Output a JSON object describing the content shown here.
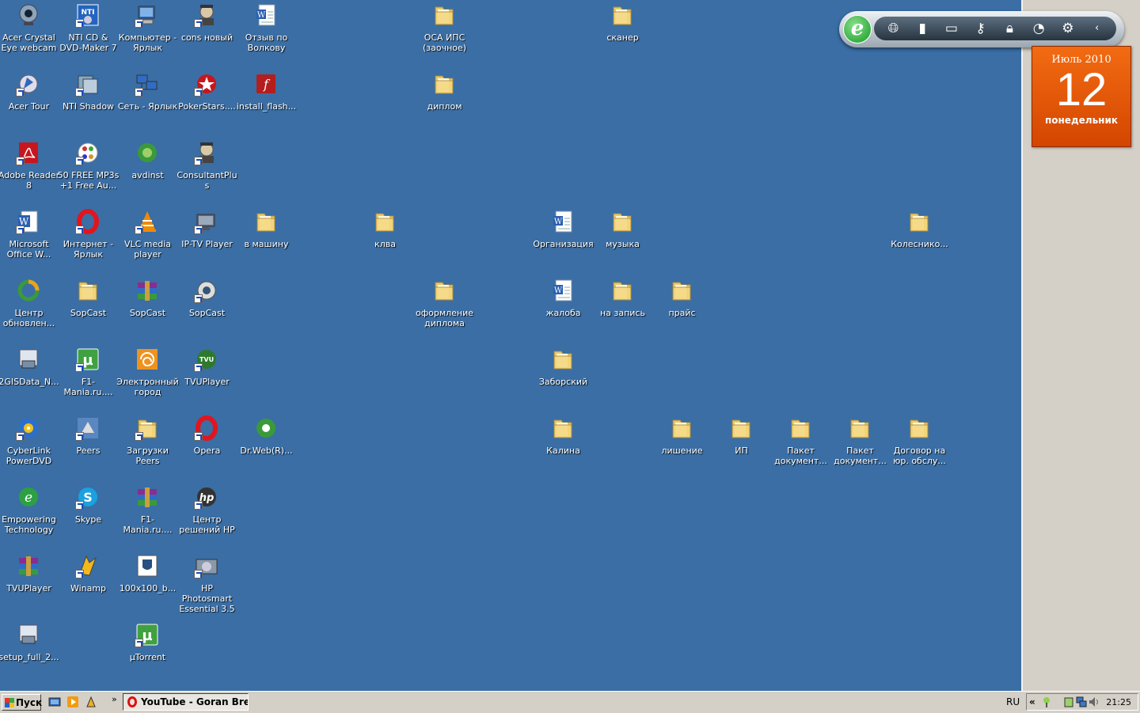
{
  "desktop": {
    "background": "#3a6ea5",
    "icons": [
      {
        "label": "Acer Crystal\nEye webcam",
        "icon": "webcam-icon",
        "shortcut": false
      },
      {
        "label": "NTI CD &\nDVD-Maker 7",
        "icon": "nti-cd-icon",
        "shortcut": true
      },
      {
        "label": "Компьютер -\nЯрлык",
        "icon": "computer-icon",
        "shortcut": true
      },
      {
        "label": "cons новый",
        "icon": "consultant-icon",
        "shortcut": true
      },
      {
        "label": "Отзыв по\nВолкову",
        "icon": "word-doc-icon",
        "shortcut": false
      },
      {
        "label": "ОСА ИПС\n(заочное)",
        "icon": "folder-icon",
        "shortcut": false
      },
      {
        "label": "сканер",
        "icon": "folder-icon",
        "shortcut": false
      },
      {
        "label": "Acer Tour",
        "icon": "acer-tour-icon",
        "shortcut": true
      },
      {
        "label": "NTI Shadow",
        "icon": "nti-shadow-icon",
        "shortcut": true
      },
      {
        "label": "Сеть - Ярлык",
        "icon": "network-icon",
        "shortcut": true
      },
      {
        "label": "PokerStars....",
        "icon": "pokerstars-icon",
        "shortcut": true
      },
      {
        "label": "install_flash...",
        "icon": "flash-installer-icon",
        "shortcut": false
      },
      {
        "label": "диплом",
        "icon": "folder-icon",
        "shortcut": false
      },
      {
        "label": "Adobe Reader\n8",
        "icon": "adobe-reader-icon",
        "shortcut": true
      },
      {
        "label": "50 FREE MP3s\n+1 Free Au...",
        "icon": "mp3-icon",
        "shortcut": true
      },
      {
        "label": "avdinst",
        "icon": "avdinst-icon",
        "shortcut": false
      },
      {
        "label": "ConsultantPlus",
        "icon": "consultant-icon",
        "shortcut": true
      },
      {
        "label": "Microsoft\nOffice W...",
        "icon": "word-icon",
        "shortcut": true
      },
      {
        "label": "Интернет -\nЯрлык",
        "icon": "opera-icon",
        "shortcut": true
      },
      {
        "label": "VLC media\nplayer",
        "icon": "vlc-icon",
        "shortcut": true
      },
      {
        "label": "IP-TV Player",
        "icon": "iptv-icon",
        "shortcut": true
      },
      {
        "label": "в машину",
        "icon": "folder-icon",
        "shortcut": false
      },
      {
        "label": "клва",
        "icon": "folder-icon",
        "shortcut": false
      },
      {
        "label": "Организация",
        "icon": "word-doc-icon",
        "shortcut": false
      },
      {
        "label": "музыка",
        "icon": "folder-icon",
        "shortcut": false
      },
      {
        "label": "Колеснико...",
        "icon": "folder-icon",
        "shortcut": false
      },
      {
        "label": "Центр\nобновлен...",
        "icon": "update-center-icon",
        "shortcut": false
      },
      {
        "label": "SopCast",
        "icon": "folder-icon",
        "shortcut": false
      },
      {
        "label": "SopCast",
        "icon": "winrar-icon",
        "shortcut": false
      },
      {
        "label": "SopCast",
        "icon": "sopcast-icon",
        "shortcut": true
      },
      {
        "label": "оформление\nдиплома",
        "icon": "folder-icon",
        "shortcut": false
      },
      {
        "label": "жалоба",
        "icon": "word-doc-icon",
        "shortcut": false
      },
      {
        "label": "на запись",
        "icon": "folder-icon",
        "shortcut": false
      },
      {
        "label": "прайс",
        "icon": "folder-icon",
        "shortcut": false
      },
      {
        "label": "2GISData_N...",
        "icon": "installer-icon",
        "shortcut": false
      },
      {
        "label": "F1-Mania.ru....",
        "icon": "utorrent-icon",
        "shortcut": true
      },
      {
        "label": "Электронный\nгород",
        "icon": "city-icon",
        "shortcut": false
      },
      {
        "label": "TVUPlayer",
        "icon": "tvu-icon",
        "shortcut": true
      },
      {
        "label": "Заборский",
        "icon": "folder-icon",
        "shortcut": false
      },
      {
        "label": "CyberLink\nPowerDVD",
        "icon": "powerdvd-icon",
        "shortcut": true
      },
      {
        "label": "Peers",
        "icon": "peers-icon",
        "shortcut": true
      },
      {
        "label": "Загрузки\nPeers",
        "icon": "folder-icon",
        "shortcut": true
      },
      {
        "label": "Opera",
        "icon": "opera-icon",
        "shortcut": true
      },
      {
        "label": "Dr.Web(R)...",
        "icon": "drweb-icon",
        "shortcut": false
      },
      {
        "label": "Калина",
        "icon": "folder-icon",
        "shortcut": false
      },
      {
        "label": "лишение",
        "icon": "folder-icon",
        "shortcut": false
      },
      {
        "label": "ИП",
        "icon": "folder-icon",
        "shortcut": false
      },
      {
        "label": "Пакет\nдокумент...",
        "icon": "folder-icon",
        "shortcut": false
      },
      {
        "label": "Пакет\nдокумент...",
        "icon": "folder-icon",
        "shortcut": false
      },
      {
        "label": "Договор на\nюр. обслу...",
        "icon": "folder-icon",
        "shortcut": false
      },
      {
        "label": "Empowering\nTechnology",
        "icon": "empowering-icon",
        "shortcut": false
      },
      {
        "label": "Skype",
        "icon": "skype-icon",
        "shortcut": true
      },
      {
        "label": "F1-Mania.ru....",
        "icon": "winrar-icon",
        "shortcut": false
      },
      {
        "label": "Центр\nрешений HP",
        "icon": "hp-icon",
        "shortcut": true
      },
      {
        "label": "TVUPlayer",
        "icon": "winrar-icon",
        "shortcut": false
      },
      {
        "label": "Winamp",
        "icon": "winamp-icon",
        "shortcut": true
      },
      {
        "label": "100x100_b...",
        "icon": "image-icon",
        "shortcut": false
      },
      {
        "label": "HP Photosmart\nEssential 3.5",
        "icon": "hp-photosmart-icon",
        "shortcut": true
      },
      {
        "label": "setup_full_2...",
        "icon": "installer-icon",
        "shortcut": false
      },
      {
        "label": "µTorrent",
        "icon": "utorrent-icon",
        "shortcut": true
      }
    ]
  },
  "gadget_bar": {
    "buttons": [
      "globe-icon",
      "battery-icon",
      "projector-icon",
      "key-icon",
      "lock-icon",
      "gauge-icon",
      "gear-icon",
      "collapse-icon"
    ]
  },
  "calendar": {
    "month": "Июль 2010",
    "day": "12",
    "weekday": "понедельник",
    "color": "#e85a0c"
  },
  "taskbar": {
    "start_label": "Пуск",
    "quick_launch": [
      "show-desktop-icon",
      "media-player-icon",
      "winamp-icon"
    ],
    "task_title": "YouTube - Goran Breg...",
    "language": "RU",
    "clock": "21:25"
  }
}
